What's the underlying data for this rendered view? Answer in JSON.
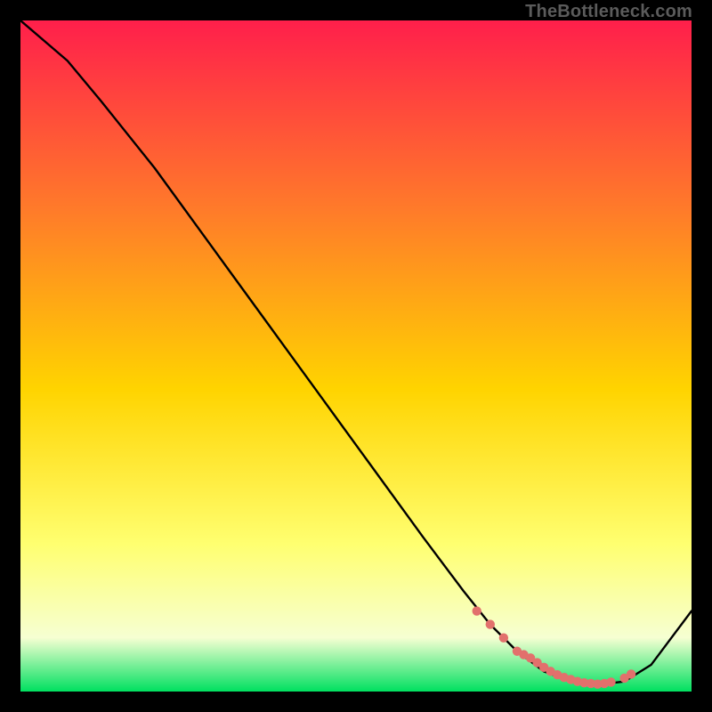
{
  "watermark": "TheBottleneck.com",
  "colors": {
    "gradient_top": "#ff1f4b",
    "gradient_mid_upper": "#ff7a2a",
    "gradient_mid": "#ffd400",
    "gradient_mid_lower": "#ffff70",
    "gradient_lower_light": "#f6ffd2",
    "gradient_bottom": "#00e060",
    "line": "#000000",
    "points": "#e2706c"
  },
  "chart_data": {
    "type": "line",
    "title": "",
    "xlabel": "",
    "ylabel": "",
    "xlim": [
      0,
      100
    ],
    "ylim": [
      0,
      100
    ],
    "grid": false,
    "series": [
      {
        "name": "curve",
        "x": [
          0,
          7,
          12,
          20,
          28,
          36,
          44,
          52,
          60,
          66,
          70,
          74,
          78,
          82,
          86,
          90,
          94,
          100
        ],
        "y": [
          100,
          94,
          88,
          78,
          67,
          56,
          45,
          34,
          23,
          15,
          10,
          6,
          3,
          1.5,
          1,
          1.5,
          4,
          12
        ]
      }
    ],
    "points": {
      "name": "highlight",
      "x": [
        68,
        70,
        72,
        74,
        75,
        76,
        77,
        78,
        79,
        80,
        81,
        82,
        83,
        84,
        85,
        86,
        87,
        88,
        90,
        91
      ],
      "y": [
        12,
        10,
        8,
        6,
        5.5,
        5,
        4.3,
        3.6,
        3,
        2.5,
        2.1,
        1.8,
        1.5,
        1.3,
        1.2,
        1.1,
        1.2,
        1.4,
        2,
        2.6
      ]
    }
  }
}
